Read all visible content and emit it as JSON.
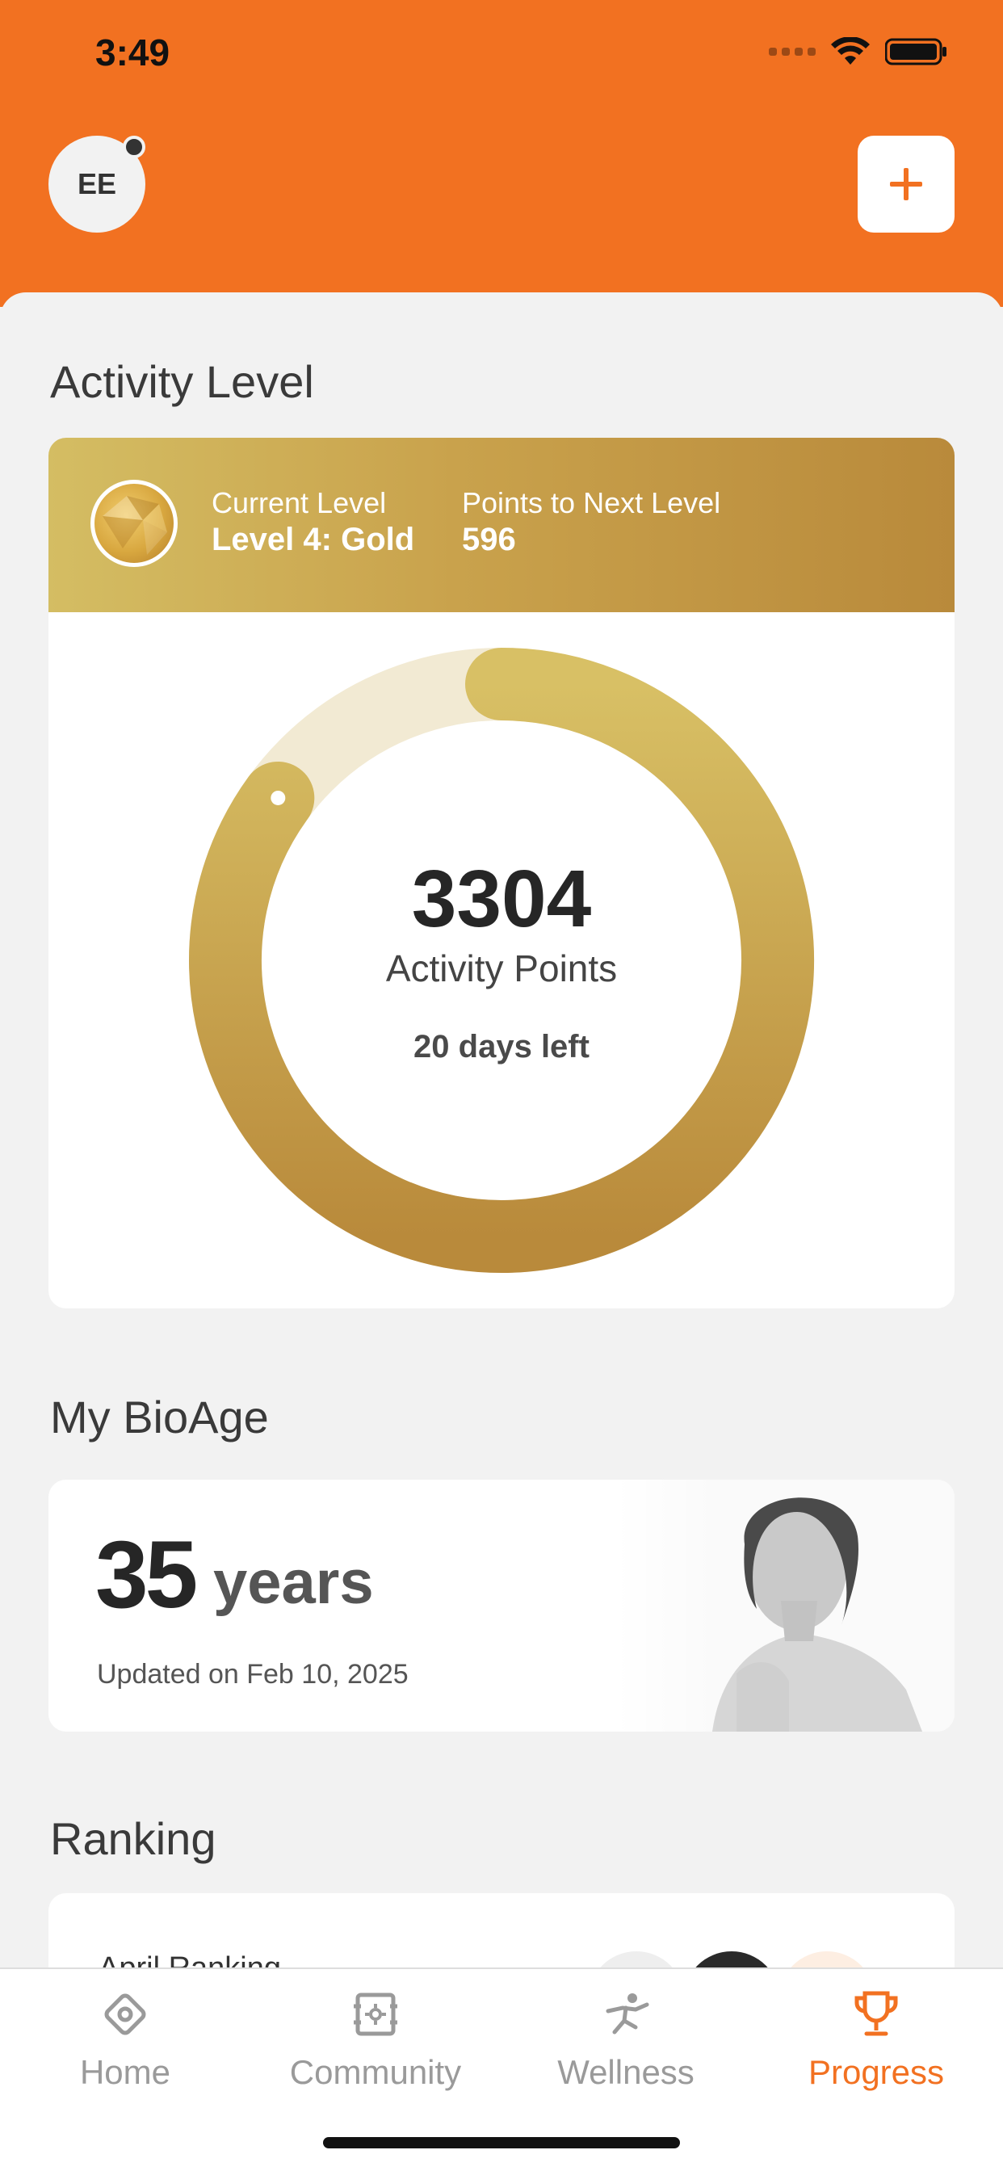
{
  "status_bar": {
    "time": "3:49"
  },
  "header": {
    "avatar_initials": "EE",
    "add_button_icon": "plus-icon"
  },
  "activity": {
    "section_title": "Activity Level",
    "current_level_label": "Current Level",
    "current_level_value": "Level 4: Gold",
    "points_next_label": "Points to Next Level",
    "points_next_value": "596",
    "points": "3304",
    "points_label": "Activity Points",
    "days_left": "20 days left",
    "progress_fraction": 0.85
  },
  "bioage": {
    "section_title": "My BioAge",
    "value": "35",
    "unit": "years",
    "updated": "Updated on Feb 10, 2025"
  },
  "ranking": {
    "section_title": "Ranking",
    "row_label": "April Ranking"
  },
  "tabbar": {
    "items": [
      {
        "label": "Home",
        "icon": "home-icon"
      },
      {
        "label": "Community",
        "icon": "community-icon"
      },
      {
        "label": "Wellness",
        "icon": "wellness-icon"
      },
      {
        "label": "Progress",
        "icon": "trophy-icon",
        "active": true
      }
    ]
  },
  "colors": {
    "accent": "#f27121",
    "gold_light": "#d4bd63",
    "gold_dark": "#b98a3b"
  }
}
